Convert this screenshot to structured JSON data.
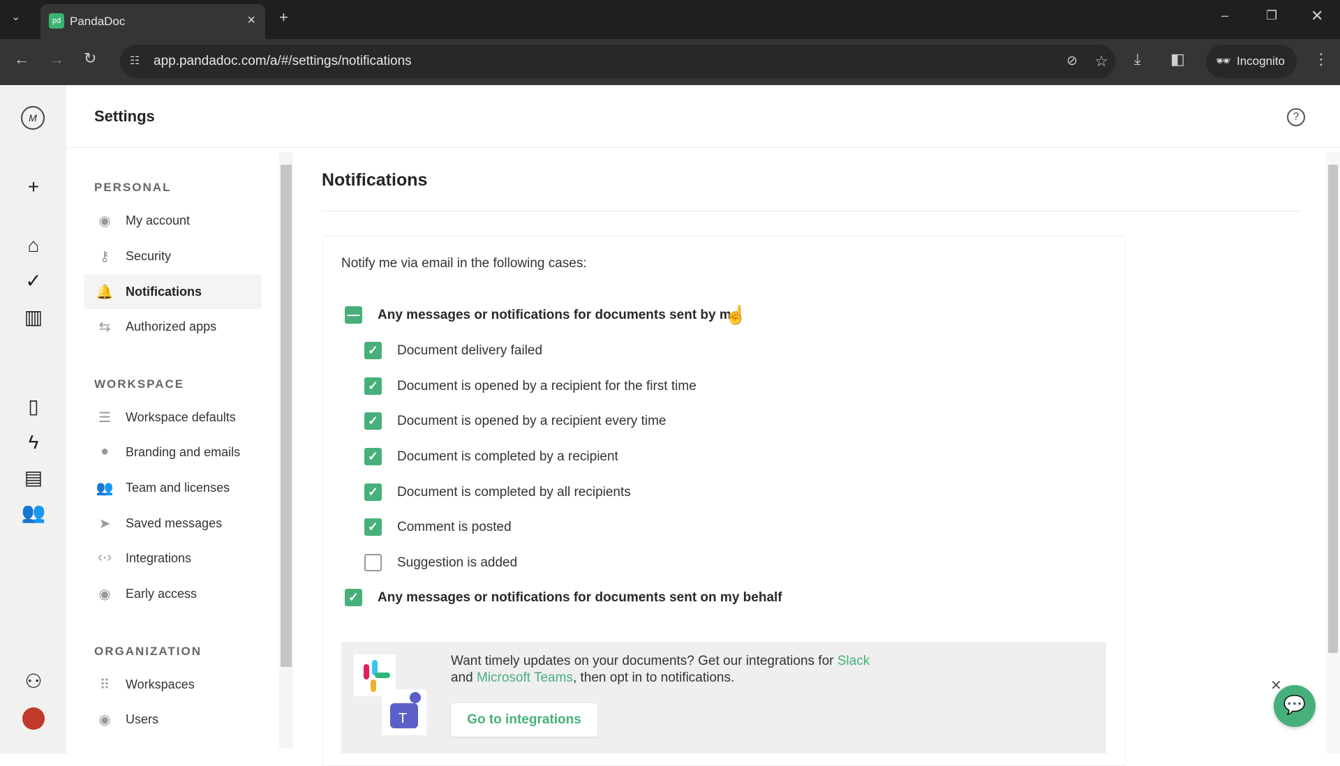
{
  "browser": {
    "tab_title": "PandaDoc",
    "tab_favicon": "pd",
    "url": "app.pandadoc.com/a/#/settings/notifications",
    "incognito_label": "Incognito"
  },
  "header": {
    "title": "Settings"
  },
  "nav": {
    "personal": {
      "heading": "PERSONAL",
      "items": [
        {
          "label": "My account",
          "icon": "user-circle-icon"
        },
        {
          "label": "Security",
          "icon": "key-icon"
        },
        {
          "label": "Notifications",
          "icon": "bell-icon"
        },
        {
          "label": "Authorized apps",
          "icon": "arrows-icon"
        }
      ]
    },
    "workspace": {
      "heading": "WORKSPACE",
      "items": [
        {
          "label": "Workspace defaults",
          "icon": "sliders-icon"
        },
        {
          "label": "Branding and emails",
          "icon": "palette-icon"
        },
        {
          "label": "Team and licenses",
          "icon": "team-icon"
        },
        {
          "label": "Saved messages",
          "icon": "send-icon"
        },
        {
          "label": "Integrations",
          "icon": "code-icon"
        },
        {
          "label": "Early access",
          "icon": "eye-icon"
        }
      ]
    },
    "organization": {
      "heading": "ORGANIZATION",
      "items": [
        {
          "label": "Workspaces",
          "icon": "grid-icon"
        },
        {
          "label": "Users",
          "icon": "user-circle-icon"
        }
      ]
    },
    "active": "Notifications"
  },
  "main": {
    "title": "Notifications",
    "intro": "Notify me via email in the following cases:",
    "group1": {
      "label": "Any messages or notifications for documents sent by me",
      "state": "indeterminate",
      "items": [
        {
          "label": "Document delivery failed",
          "checked": true
        },
        {
          "label": "Document is opened by a recipient for the first time",
          "checked": true
        },
        {
          "label": "Document is opened by a recipient every time",
          "checked": true
        },
        {
          "label": "Document is completed by a recipient",
          "checked": true
        },
        {
          "label": "Document is completed by all recipients",
          "checked": true
        },
        {
          "label": "Comment is posted",
          "checked": true
        },
        {
          "label": "Suggestion is added",
          "checked": false
        }
      ]
    },
    "group2": {
      "label": "Any messages or notifications for documents sent on my behalf",
      "state": "checked"
    },
    "banner": {
      "text1": "Want timely updates on your documents? Get our integrations for ",
      "slack": "Slack",
      "text2": "and ",
      "teams": "Microsoft Teams",
      "text3": ", then opt in to notifications.",
      "button": "Go to integrations"
    }
  },
  "colors": {
    "accent": "#47b07a",
    "rail": "#f3f1ef"
  }
}
